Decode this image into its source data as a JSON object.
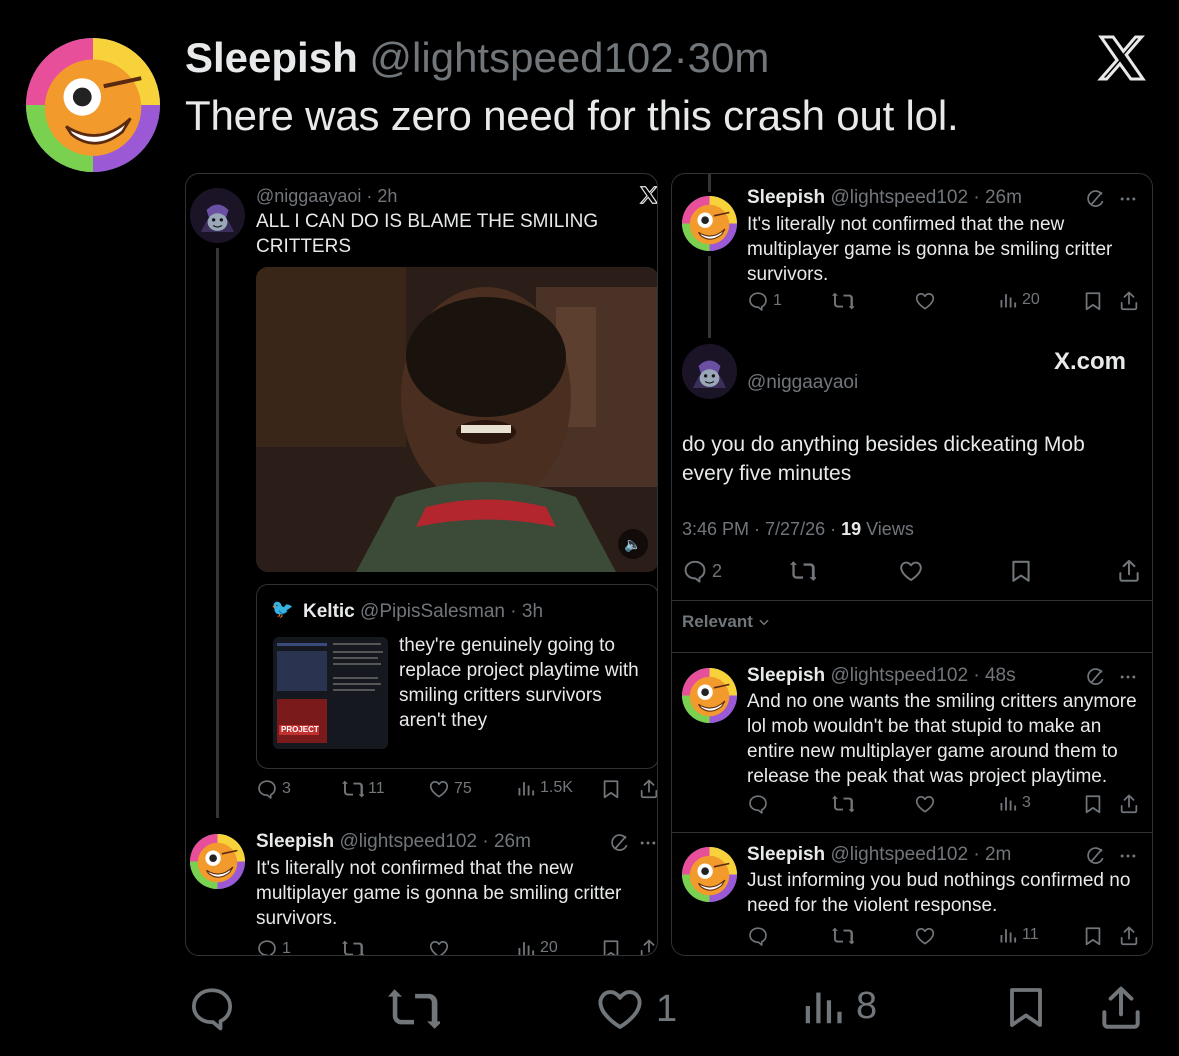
{
  "post": {
    "author": "Sleepish",
    "handle": "@lightspeed102",
    "time": "30m",
    "text": "There was zero need for this crash out lol.",
    "counts": {
      "replies": "",
      "reposts": "",
      "likes": "1",
      "views": "8"
    }
  },
  "left_screenshot": {
    "tweet1": {
      "handle": "@niggaayaoi",
      "time": "2h",
      "text": "ALL I CAN DO IS BLAME THE SMILING CRITTERS"
    },
    "quote": {
      "author": "Keltic",
      "handle": "@PipisSalesman",
      "time": "3h",
      "text_lines": [
        "they're genuinely going to",
        "replace project playtime with",
        "smiling critters survivors",
        "aren't they"
      ],
      "thumb_label": "PROJECT"
    },
    "tweet1_counts": {
      "replies": "3",
      "reposts": "11",
      "likes": "75",
      "views": "1.5K"
    },
    "reply": {
      "author": "Sleepish",
      "handle": "@lightspeed102",
      "time": "26m",
      "text_lines": [
        "It's literally not confirmed that the new",
        "multiplayer game is gonna be smiling critter",
        "survivors."
      ],
      "counts": {
        "replies": "1",
        "views": "20"
      }
    }
  },
  "right_screenshot": {
    "reply_top": {
      "author": "Sleepish",
      "handle": "@lightspeed102",
      "time": "26m",
      "text_lines": [
        "It's literally not confirmed that the new",
        "multiplayer game is gonna be smiling critter",
        "survivors."
      ],
      "counts": {
        "replies": "1",
        "views": "20"
      }
    },
    "main": {
      "handle": "@niggaayaoi",
      "watermark": "X.com",
      "text_lines": [
        "do you do anything besides dickeating Mob",
        "every five minutes"
      ],
      "timestamp": "3:46 PM · 7/27/26 · ",
      "views_count": "19",
      "views_label": " Views",
      "counts": {
        "replies": "2"
      }
    },
    "relevant_label": "Relevant",
    "reply2": {
      "author": "Sleepish",
      "handle": "@lightspeed102",
      "time": "48s",
      "text_lines": [
        "And no one wants the  smiling critters anymore",
        "lol mob wouldn't be that stupid to make an",
        "entire new multiplayer game around them to",
        "release the peak that was project playtime."
      ],
      "counts": {
        "views": "3"
      }
    },
    "reply3": {
      "author": "Sleepish",
      "handle": "@lightspeed102",
      "time": "2m",
      "text_lines": [
        "Just informing you bud nothings confirmed no",
        "need for the violent response."
      ],
      "counts": {
        "views": "11"
      }
    }
  },
  "icons": {
    "logo": "x-logo-icon",
    "reply": "reply-icon",
    "repost": "repost-icon",
    "like": "heart-icon",
    "views": "views-icon",
    "bookmark": "bookmark-icon",
    "share": "share-icon",
    "grok": "grok-icon",
    "more": "more-icon",
    "sound": "sound-icon",
    "chevron": "chevron-down-icon"
  },
  "colors": {
    "background": "#000000",
    "text": "#e7e9ea",
    "muted": "#71767b",
    "border": "#2f3336"
  }
}
